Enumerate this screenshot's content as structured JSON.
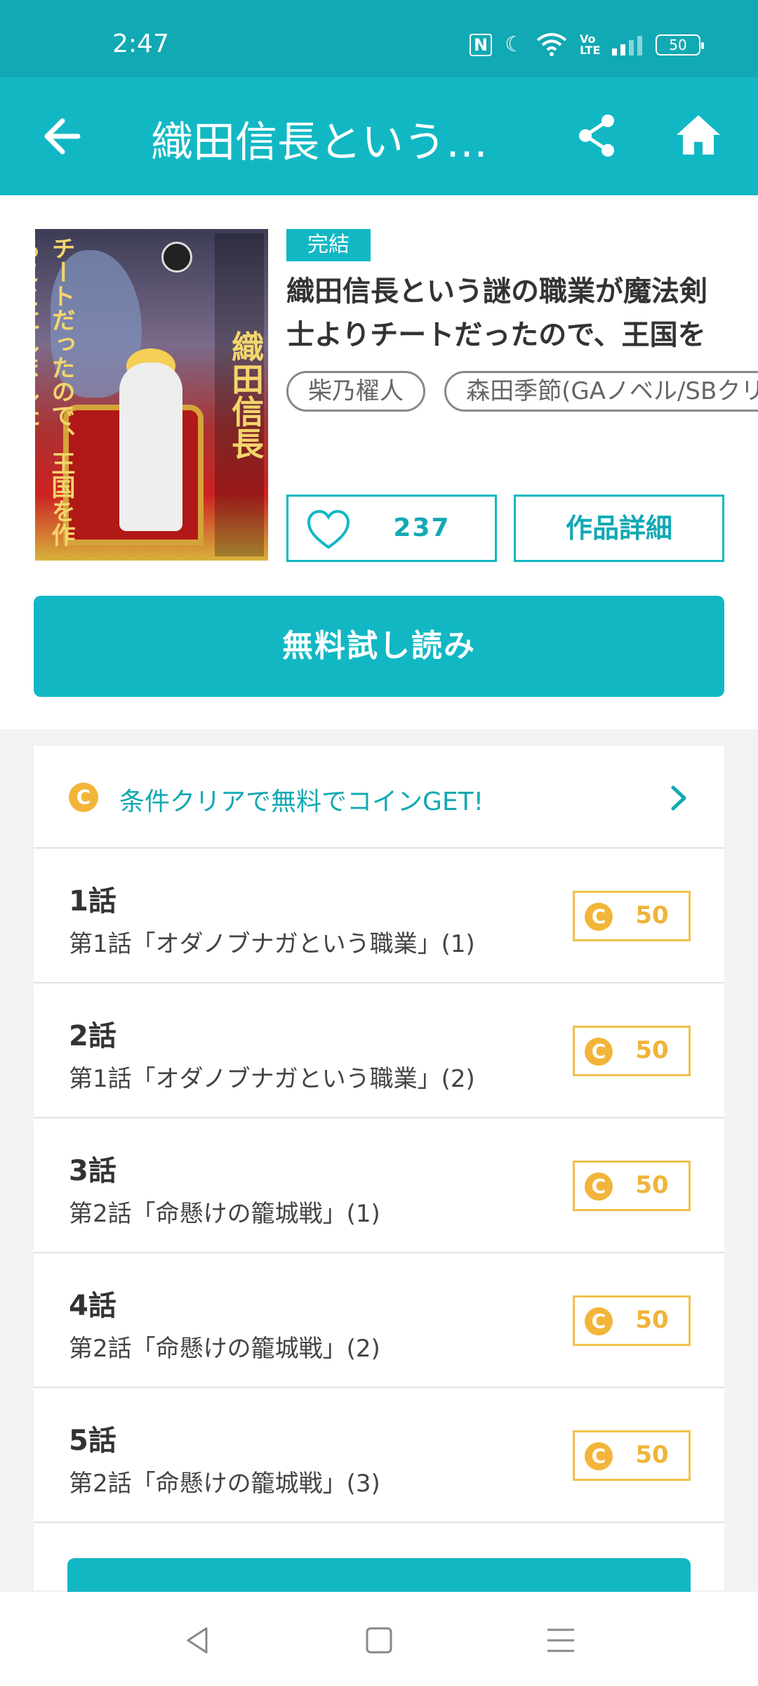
{
  "status_bar": {
    "time": "2:47",
    "battery": "50",
    "nfc": "N",
    "volte": "Vo LTE"
  },
  "app_bar": {
    "title": "織田信長という謎の職業が魔法剣士よりチートだったので、王国を作ることにしました"
  },
  "work": {
    "status_badge": "完結",
    "title": "織田信長という謎の職業が魔法剣士よりチートだったので、王国を作ることにしました",
    "authors": [
      "柴乃櫂人",
      "森田季節(GAノベル/SBクリエイティブ刊)"
    ],
    "likes": "237",
    "detail_label": "作品詳細",
    "free_read_label": "無料試し読み",
    "cover": {
      "title_vertical": "織田信長",
      "sub_vertical": "チートだったので、王国を作ることにしました"
    }
  },
  "promo": {
    "coin_symbol": "C",
    "text": "条件クリアで無料でコインGET!"
  },
  "episodes": [
    {
      "num": "1話",
      "subtitle": "第1話「オダノブナガという職業」(1)",
      "price": "50"
    },
    {
      "num": "2話",
      "subtitle": "第1話「オダノブナガという職業」(2)",
      "price": "50"
    },
    {
      "num": "3話",
      "subtitle": "第2話「命懸けの籠城戦」(1)",
      "price": "50"
    },
    {
      "num": "4話",
      "subtitle": "第2話「命懸けの籠城戦」(2)",
      "price": "50"
    },
    {
      "num": "5話",
      "subtitle": "第2話「命懸けの籠城戦」(3)",
      "price": "50"
    }
  ],
  "colors": {
    "primary": "#11b8c4",
    "status_bar": "#11a9b3",
    "coin": "#f2b53a"
  },
  "icons": {
    "back": "back-arrow-icon",
    "share": "share-icon",
    "home": "home-icon",
    "heart": "heart-icon",
    "chevron": "chevron-right-icon",
    "nav_back": "nav-back-icon",
    "nav_home": "nav-home-icon",
    "nav_menu": "nav-menu-icon"
  }
}
